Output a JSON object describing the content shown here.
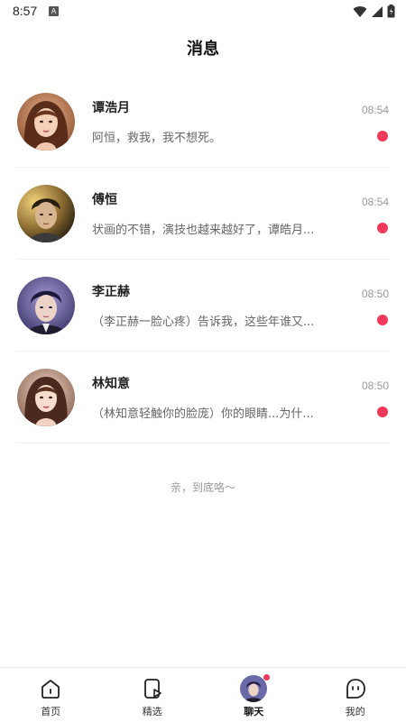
{
  "status_bar": {
    "time": "8:57",
    "notification_icon": "a-app-icon",
    "icons": [
      "wifi-icon",
      "signal-icon",
      "battery-icon"
    ]
  },
  "page": {
    "title": "消息"
  },
  "chats": [
    {
      "name": "谭浩月",
      "time": "08:54",
      "preview": "阿恒，救我，我不想死。",
      "unread": true,
      "avatar": "avatar-girl-brown-hair"
    },
    {
      "name": "傅恒",
      "time": "08:54",
      "preview": "状画的不错，演技也越来越好了，谭皓月...",
      "unread": true,
      "avatar": "avatar-man-golden-light"
    },
    {
      "name": "李正赫",
      "time": "08:50",
      "preview": "（李正赫一脸心疼）告诉我，这些年谁又...",
      "unread": true,
      "avatar": "avatar-man-purple-bg"
    },
    {
      "name": "林知意",
      "time": "08:50",
      "preview": "（林知意轻触你的脸庞）你的眼睛...为什...",
      "unread": true,
      "avatar": "avatar-girl-long-hair"
    }
  ],
  "end_text": "亲，到底咯～",
  "tabs": [
    {
      "label": "首页",
      "icon": "home-icon",
      "active": false
    },
    {
      "label": "精选",
      "icon": "play-card-icon",
      "active": false
    },
    {
      "label": "聊天",
      "icon": "avatar-icon",
      "active": true
    },
    {
      "label": "我的",
      "icon": "chat-bubble-face-icon",
      "active": false
    }
  ],
  "colors": {
    "unread": "#f2395c",
    "time": "#9a9a9a",
    "preview": "#666666"
  }
}
